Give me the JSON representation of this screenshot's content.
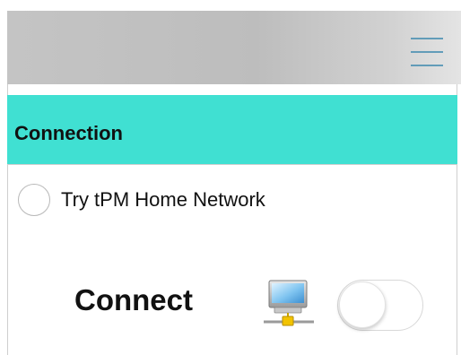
{
  "header": {
    "menu_icon": "hamburger-menu-icon",
    "menu_color": "#3a87ad"
  },
  "section": {
    "title": "Connection",
    "color": "#40e0d2"
  },
  "options": [
    {
      "label": "Try tPM Home Network",
      "selected": false
    }
  ],
  "connect": {
    "label": "Connect",
    "icon": "network-computer-icon",
    "toggle_on": false
  }
}
